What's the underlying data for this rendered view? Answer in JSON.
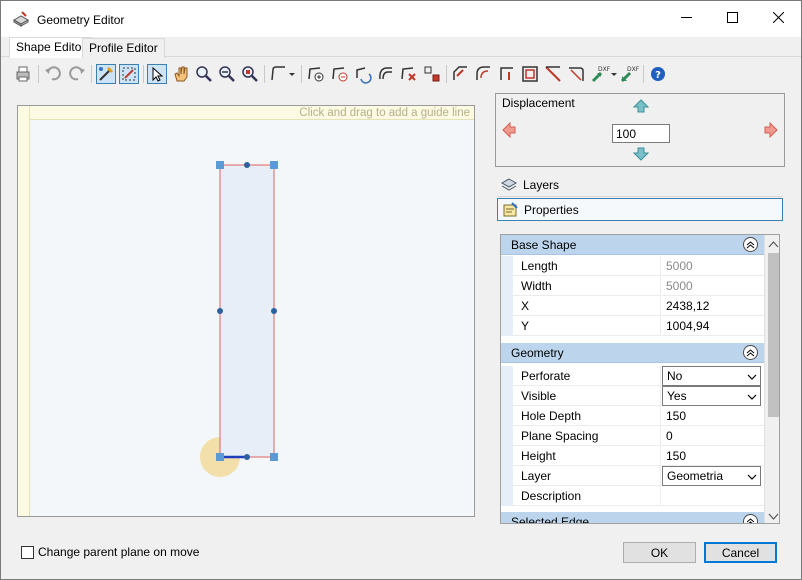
{
  "window": {
    "title": "Geometry Editor"
  },
  "tabs": [
    {
      "label": "Shape Editor",
      "active": true
    },
    {
      "label": "Profile Editor",
      "active": false
    }
  ],
  "toolbar_icons": [
    "print-icon",
    "undo-icon",
    "redo-icon",
    "snap-edit-icon",
    "snap-tool-icon",
    "pointer-icon",
    "pan-hand-icon",
    "zoom-in-icon",
    "zoom-out-icon",
    "zoom-fit-icon",
    "polyline-icon",
    "add-point-icon",
    "remove-point-icon",
    "rotate-shape-icon",
    "copy-shape-icon",
    "delete-shape-icon",
    "transform-icon",
    "cut-corner-icon",
    "round-corner-icon",
    "notch-icon",
    "offset-icon",
    "chamfer-icon",
    "fillet-icon",
    "import-dxf-icon",
    "export-dxf-icon",
    "help-icon"
  ],
  "canvas": {
    "guide_hint": "Click and drag to add a guide line"
  },
  "displacement": {
    "title": "Displacement",
    "value": "100"
  },
  "panels": {
    "layers": "Layers",
    "properties": "Properties"
  },
  "property_grid": {
    "categories": [
      {
        "name": "Base Shape",
        "rows": [
          {
            "name": "Length",
            "value": "5000",
            "readonly": true
          },
          {
            "name": "Width",
            "value": "5000",
            "readonly": true
          },
          {
            "name": "X",
            "value": "2438,12",
            "readonly": false
          },
          {
            "name": "Y",
            "value": "1004,94",
            "readonly": false
          }
        ]
      },
      {
        "name": "Geometry",
        "rows": [
          {
            "name": "Perforate",
            "value": "No",
            "dropdown": true
          },
          {
            "name": "Visible",
            "value": "Yes",
            "dropdown": true
          },
          {
            "name": "Hole Depth",
            "value": "150"
          },
          {
            "name": "Plane Spacing",
            "value": "0"
          },
          {
            "name": "Height",
            "value": "150"
          },
          {
            "name": "Layer",
            "value": "Geometria",
            "dropdown": true
          },
          {
            "name": "Description",
            "value": ""
          }
        ]
      },
      {
        "name": "Selected Edge",
        "rows": []
      }
    ]
  },
  "footer": {
    "checkbox_label": "Change parent plane on move",
    "checkbox_checked": false,
    "ok_label": "OK",
    "cancel_label": "Cancel"
  },
  "colors": {
    "accent": "#0078d7",
    "selection_border": "#3c7fb1",
    "category_header": "#bcd5ed",
    "shape_outline": "#e06060",
    "handle": "#5b9bd5",
    "vertex_dot": "#2e5f9e",
    "highlight": "#f3dca0"
  }
}
